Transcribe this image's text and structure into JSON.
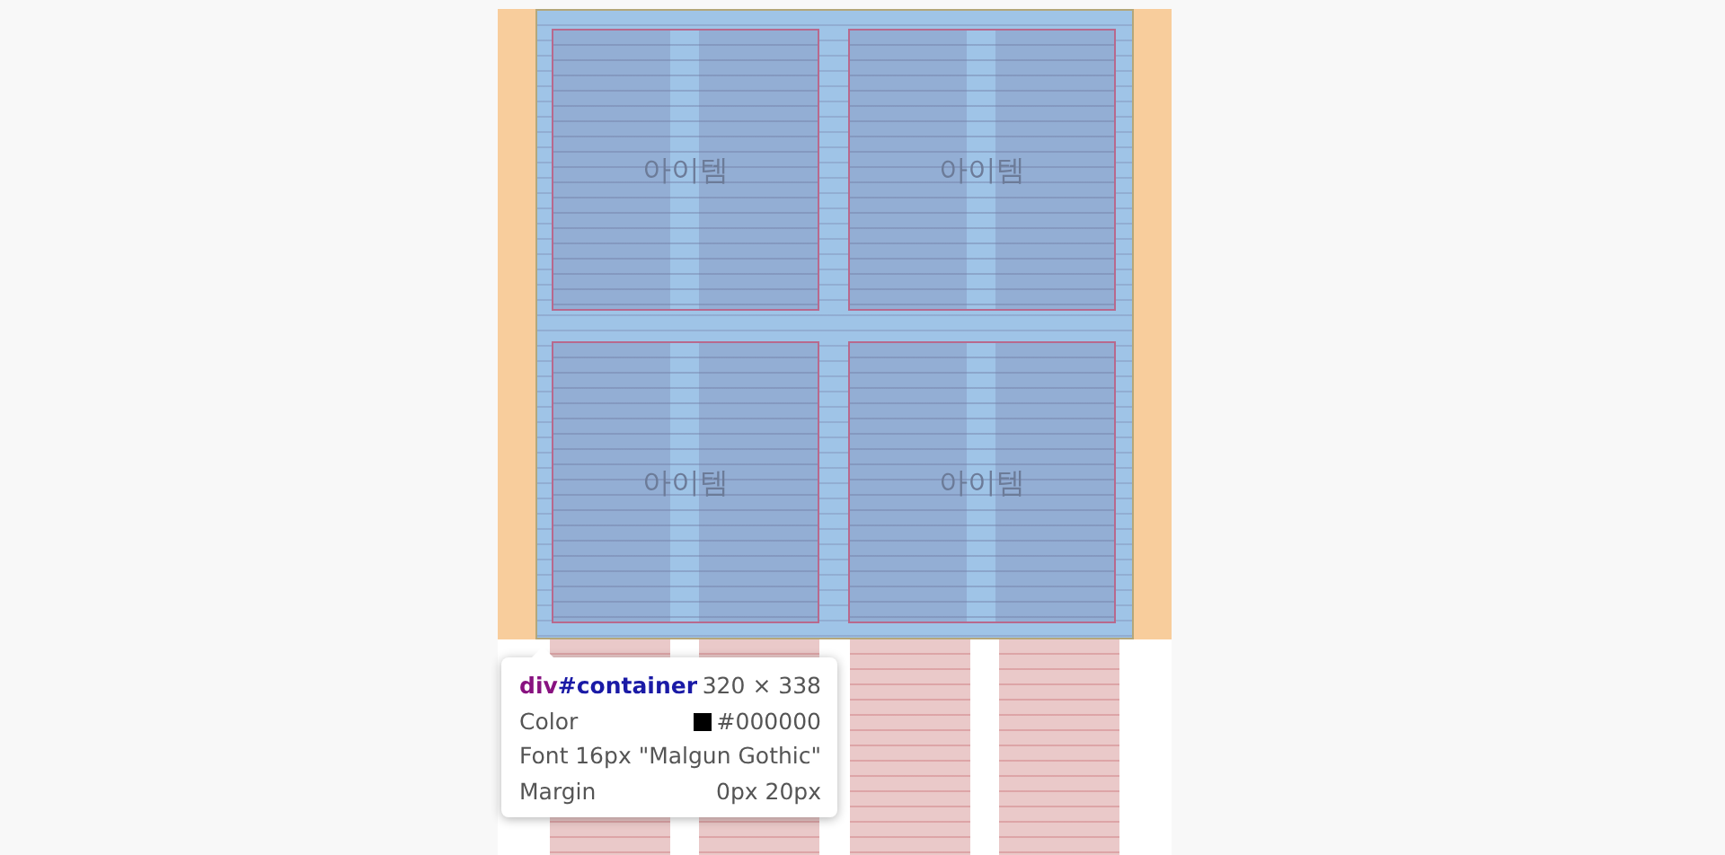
{
  "grid_items": [
    {
      "label": "아이템"
    },
    {
      "label": "아이템"
    },
    {
      "label": "아이템"
    },
    {
      "label": "아이템"
    }
  ],
  "tooltip": {
    "tag": "div",
    "id": "#container",
    "size": "320 × 338",
    "properties": [
      {
        "name": "Color",
        "value": "#000000",
        "color": "#000000"
      },
      {
        "name": "Font",
        "value": "16px \"Malgun Gothic\""
      },
      {
        "name": "Margin",
        "value": "0px 20px"
      }
    ]
  }
}
